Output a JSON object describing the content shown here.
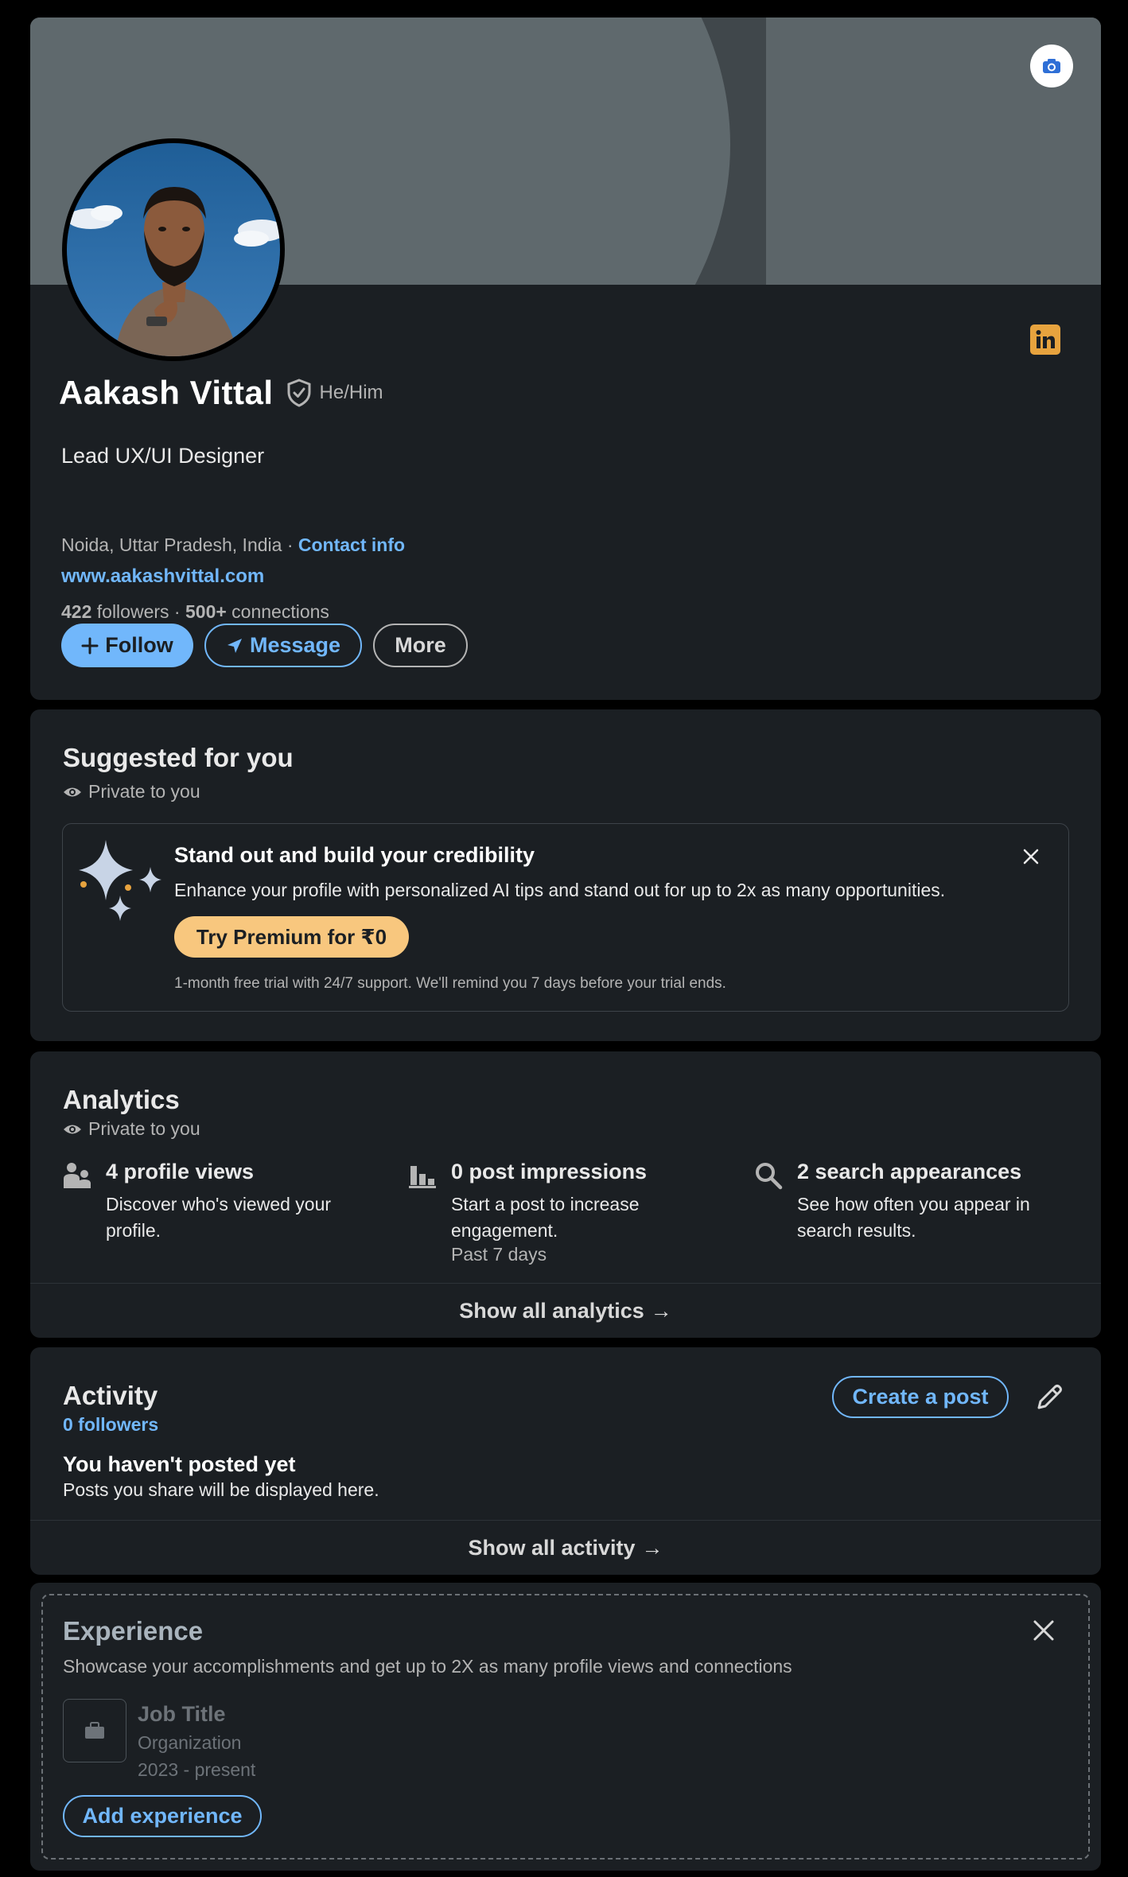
{
  "profile": {
    "name": "Aakash Vittal",
    "pronouns": "He/Him",
    "headline": "Lead UX/UI Designer",
    "location": "Noida, Uttar Pradesh, India",
    "location_sep": " · ",
    "contact_info": "Contact info",
    "website": "www.aakashvittal.com",
    "followers_count": "422",
    "followers_label": " followers",
    "connections_sep": " · ",
    "connections_count": "500+",
    "connections_label": " connections",
    "buttons": {
      "follow": "Follow",
      "message": "Message",
      "more": "More"
    }
  },
  "suggested": {
    "title": "Suggested for you",
    "private": "Private to you",
    "promo_title": "Stand out and build your credibility",
    "promo_desc": "Enhance your profile with personalized AI tips and stand out for up to 2x as many opportunities.",
    "promo_button": "Try Premium for ₹0",
    "promo_note": "1-month free trial with 24/7 support. We'll remind you 7 days before your trial ends."
  },
  "analytics": {
    "title": "Analytics",
    "private": "Private to you",
    "stats": [
      {
        "title": "4 profile views",
        "desc": "Discover who's viewed your profile.",
        "sub": ""
      },
      {
        "title": "0 post impressions",
        "desc": "Start a post to increase engagement.",
        "sub": "Past 7 days"
      },
      {
        "title": "2 search appearances",
        "desc": "See how often you appear in search results.",
        "sub": ""
      }
    ],
    "footer": "Show all analytics",
    "arrow": "→"
  },
  "activity": {
    "title": "Activity",
    "followers": "0 followers",
    "create_post": "Create a post",
    "empty_title": "You haven't posted yet",
    "empty_desc": "Posts you share will be displayed here.",
    "footer": "Show all activity",
    "arrow": "→"
  },
  "experience": {
    "title": "Experience",
    "desc": "Showcase your accomplishments and get up to 2X as many profile views and connections",
    "job_title": "Job Title",
    "organization": "Organization",
    "dates": "2023 - present",
    "add_button": "Add experience"
  },
  "colors": {
    "accent": "#71b7fb",
    "premium": "#f8c77e",
    "card_bg": "#1b1f23",
    "page_bg": "#000000"
  },
  "icons": [
    "camera-icon",
    "linkedin-icon",
    "verified-shield-icon",
    "plus-icon",
    "send-icon",
    "eye-icon",
    "sparkles-icon",
    "close-icon",
    "people-icon",
    "bar-chart-icon",
    "search-icon",
    "arrow-right-icon",
    "pencil-icon",
    "briefcase-icon"
  ]
}
